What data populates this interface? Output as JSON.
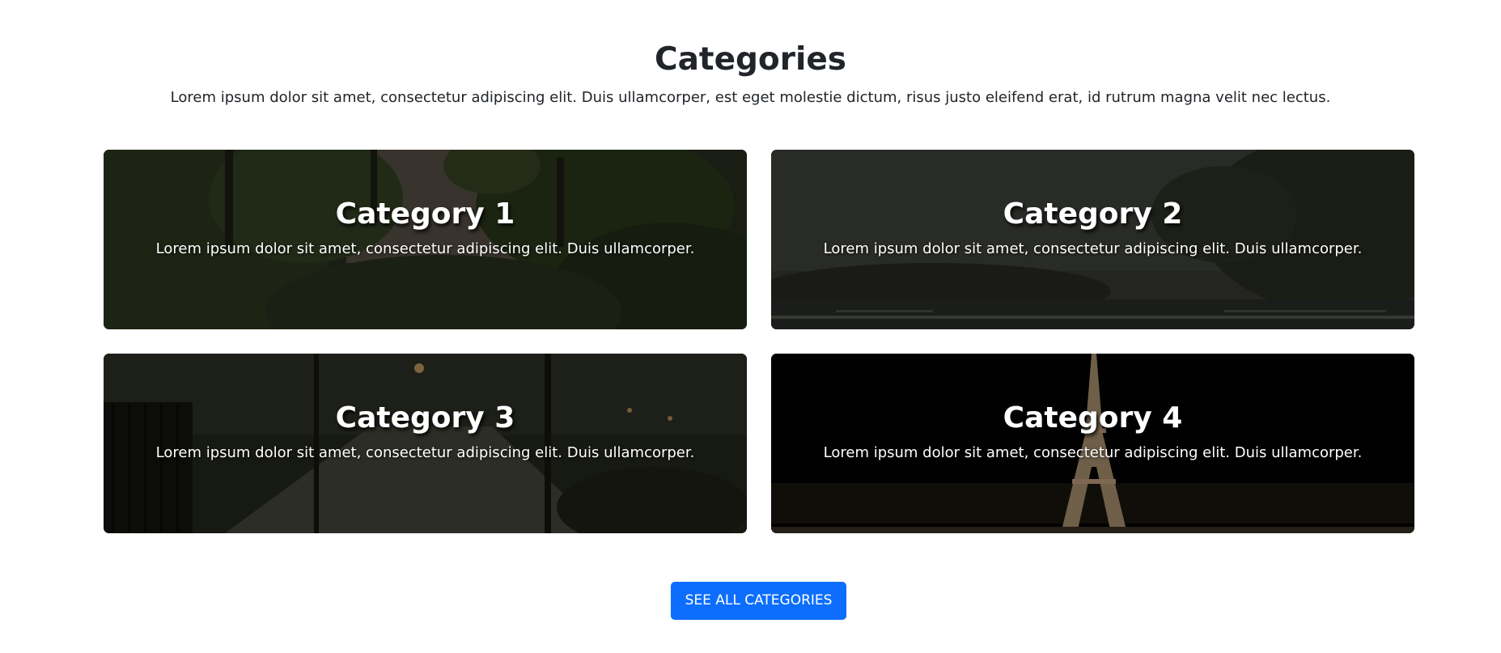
{
  "header": {
    "title": "Categories",
    "subtitle": "Lorem ipsum dolor sit amet, consectetur adipiscing elit. Duis ullamcorper, est eget molestie dictum, risus justo eleifend erat, id rutrum magna velit nec lectus."
  },
  "categories": [
    {
      "title": "Category 1",
      "text": "Lorem ipsum dolor sit amet, consectetur adipiscing elit. Duis ullamcorper."
    },
    {
      "title": "Category 2",
      "text": "Lorem ipsum dolor sit amet, consectetur adipiscing elit. Duis ullamcorper."
    },
    {
      "title": "Category 3",
      "text": "Lorem ipsum dolor sit amet, consectetur adipiscing elit. Duis ullamcorper."
    },
    {
      "title": "Category 4",
      "text": "Lorem ipsum dolor sit amet, consectetur adipiscing elit. Duis ullamcorper."
    }
  ],
  "cta": {
    "label": "SEE ALL CATEGORIES"
  },
  "colors": {
    "button": "#0d6efd",
    "heading": "#212529"
  }
}
